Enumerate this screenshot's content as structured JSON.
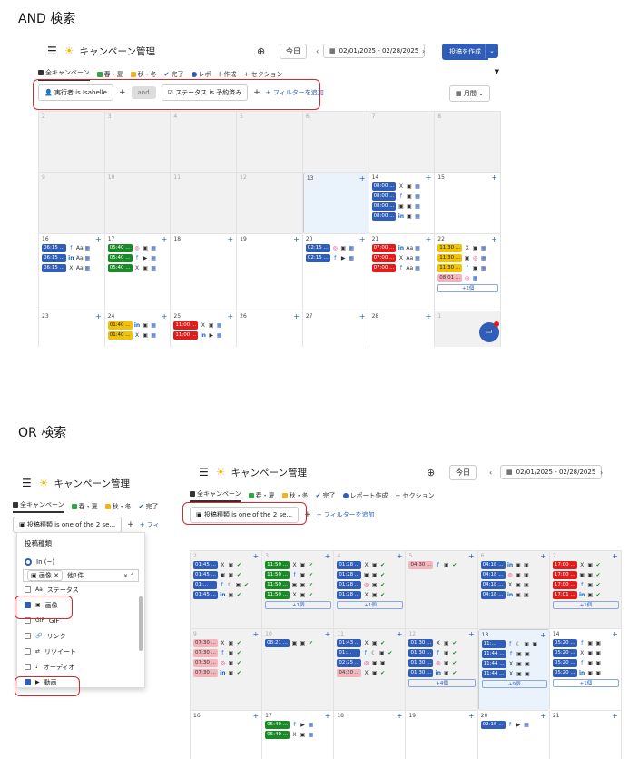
{
  "sections": {
    "and_title": "AND 検索",
    "or_title": "OR 検索"
  },
  "app": {
    "title": "キャンペーン管理",
    "today": "今日",
    "date_range": "02/01/2025 - 02/28/2025",
    "create_button": "投稿を作成",
    "view": "月間"
  },
  "tabs": [
    {
      "label": "全キャンペーン",
      "color": "#333333"
    },
    {
      "label": "春・夏",
      "color": "#2aa84a"
    },
    {
      "label": "秋・冬",
      "color": "#f2b321"
    },
    {
      "label": "完了",
      "color": "#2f5db7"
    },
    {
      "label": "レポート作成",
      "color": "#2f5db7"
    },
    {
      "label": "+ セクション",
      "color": ""
    }
  ],
  "filters_and": {
    "chip1": "実行者 is Isabelle",
    "and_label": "and",
    "chip2": "ステータス is 予約済み",
    "add": "+ フィルターを追加"
  },
  "filters_or": {
    "chip1": "投稿種類 is one of the 2 se...",
    "add": "+ フィルターを追加"
  },
  "dropdown": {
    "title": "投稿種類",
    "operator": "In (~)",
    "selected_chip": "画像",
    "selected_count": "他1件",
    "options": [
      {
        "label": "ステータス",
        "icon": "Aa",
        "checked": false
      },
      {
        "label": "画像",
        "icon": "image",
        "checked": true
      },
      {
        "label": "GIF",
        "icon": "GIF",
        "checked": false
      },
      {
        "label": "リンク",
        "icon": "link",
        "checked": false
      },
      {
        "label": "リツイート",
        "icon": "retweet",
        "checked": false
      },
      {
        "label": "オーディオ",
        "icon": "audio",
        "checked": false
      },
      {
        "label": "動画",
        "icon": "video",
        "checked": true
      }
    ],
    "row_peek": "07:30..."
  },
  "and_calendar": [
    [
      {
        "d": "2",
        "grey": true,
        "posts": []
      },
      {
        "d": "3",
        "grey": true,
        "posts": []
      },
      {
        "d": "4",
        "grey": true,
        "posts": []
      },
      {
        "d": "5",
        "grey": true,
        "posts": []
      },
      {
        "d": "6",
        "grey": true,
        "posts": []
      },
      {
        "d": "7",
        "grey": true,
        "posts": []
      },
      {
        "d": "8",
        "grey": true,
        "posts": []
      }
    ],
    [
      {
        "d": "9",
        "grey": true,
        "posts": []
      },
      {
        "d": "10",
        "grey": true,
        "posts": []
      },
      {
        "d": "11",
        "grey": true,
        "posts": []
      },
      {
        "d": "12",
        "grey": true,
        "posts": []
      },
      {
        "d": "13",
        "today": true,
        "posts": []
      },
      {
        "d": "14",
        "posts": [
          {
            "t": "08:00 ...",
            "c": "blue",
            "i": [
              "x",
              "img",
              "cal"
            ]
          },
          {
            "t": "08:00 ...",
            "c": "blue",
            "i": [
              "fb",
              "img",
              "cal"
            ]
          },
          {
            "t": "08:00 ...",
            "c": "blue",
            "i": [
              "img",
              "img",
              "cal"
            ]
          },
          {
            "t": "08:00 ...",
            "c": "blue",
            "i": [
              "li",
              "img",
              "cal"
            ]
          }
        ]
      },
      {
        "d": "15",
        "posts": []
      }
    ],
    [
      {
        "d": "16",
        "posts": [
          {
            "t": "06:15 ...",
            "c": "blue",
            "i": [
              "fb",
              "Aa",
              "cal"
            ]
          },
          {
            "t": "06:15 ...",
            "c": "blue",
            "i": [
              "li",
              "Aa",
              "cal"
            ]
          },
          {
            "t": "06:15 ...",
            "c": "blue",
            "i": [
              "x",
              "Aa",
              "cal"
            ]
          }
        ]
      },
      {
        "d": "17",
        "posts": [
          {
            "t": "05:40 ...",
            "c": "green",
            "i": [
              "ig",
              "img",
              "cal"
            ]
          },
          {
            "t": "05:40 ...",
            "c": "green",
            "i": [
              "fb",
              "vid",
              "cal"
            ]
          },
          {
            "t": "05:40 ...",
            "c": "green",
            "i": [
              "x",
              "img",
              "cal"
            ]
          }
        ]
      },
      {
        "d": "18",
        "posts": []
      },
      {
        "d": "19",
        "posts": []
      },
      {
        "d": "20",
        "posts": [
          {
            "t": "02:15 ...",
            "c": "blue",
            "i": [
              "ig",
              "img",
              "cal"
            ]
          },
          {
            "t": "02:15 ...",
            "c": "blue",
            "i": [
              "fb",
              "vid",
              "cal"
            ]
          }
        ]
      },
      {
        "d": "21",
        "posts": [
          {
            "t": "07:00 ...",
            "c": "red",
            "i": [
              "li",
              "Aa",
              "cal"
            ]
          },
          {
            "t": "07:00 ...",
            "c": "red",
            "i": [
              "x",
              "Aa",
              "cal"
            ]
          },
          {
            "t": "07:00 ...",
            "c": "red",
            "i": [
              "fb",
              "Aa",
              "cal"
            ]
          }
        ]
      },
      {
        "d": "22",
        "posts": [
          {
            "t": "11:30 ...",
            "c": "yellow",
            "i": [
              "x",
              "img",
              "cal"
            ]
          },
          {
            "t": "11:30 ...",
            "c": "yellow",
            "i": [
              "img",
              "ig",
              "cal"
            ]
          },
          {
            "t": "11:30 ...",
            "c": "yellow",
            "i": [
              "fb",
              "img",
              "cal"
            ]
          },
          {
            "t": "08:01 ...",
            "c": "pink",
            "i": [
              "ig",
              "cal"
            ]
          }
        ],
        "more": "+2個"
      }
    ],
    [
      {
        "d": "23",
        "posts": []
      },
      {
        "d": "24",
        "posts": [
          {
            "t": "01:40 ...",
            "c": "yellow",
            "i": [
              "li",
              "img",
              "cal"
            ]
          },
          {
            "t": "01:40 ...",
            "c": "yellow",
            "i": [
              "x",
              "img",
              "cal"
            ]
          }
        ]
      },
      {
        "d": "25",
        "posts": [
          {
            "t": "11:00 ...",
            "c": "red",
            "i": [
              "x",
              "img",
              "cal"
            ]
          },
          {
            "t": "11:00 ...",
            "c": "red",
            "i": [
              "li",
              "vid",
              "cal"
            ]
          }
        ]
      },
      {
        "d": "26",
        "posts": []
      },
      {
        "d": "27",
        "posts": []
      },
      {
        "d": "28",
        "posts": []
      },
      {
        "d": "1",
        "grey": true,
        "posts": []
      }
    ]
  ],
  "or_calendar": [
    [
      {
        "d": "2",
        "grey": true,
        "posts": [
          {
            "t": "01:45 ...",
            "c": "blue",
            "i": [
              "x",
              "img",
              "ck"
            ]
          },
          {
            "t": "01:45 ...",
            "c": "blue",
            "i": [
              "img",
              "img",
              "ck"
            ]
          },
          {
            "t": "01:...",
            "c": "blue",
            "i": [
              "fb",
              "moon",
              "img",
              "ck"
            ]
          },
          {
            "t": "01:45 ...",
            "c": "blue",
            "i": [
              "li",
              "img",
              "ck"
            ]
          }
        ]
      },
      {
        "d": "3",
        "grey": true,
        "posts": [
          {
            "t": "11:50 ...",
            "c": "green",
            "i": [
              "x",
              "img",
              "ck"
            ]
          },
          {
            "t": "11:50 ...",
            "c": "green",
            "i": [
              "fb",
              "img",
              "ck"
            ]
          },
          {
            "t": "11:50 ...",
            "c": "green",
            "i": [
              "img",
              "img",
              "ck"
            ]
          },
          {
            "t": "11:50 ...",
            "c": "green",
            "i": [
              "x",
              "img",
              "ck"
            ]
          }
        ],
        "more": "+1個"
      },
      {
        "d": "4",
        "grey": true,
        "posts": [
          {
            "t": "01:28 ...",
            "c": "blue",
            "i": [
              "x",
              "img",
              "ck"
            ]
          },
          {
            "t": "01:28 ...",
            "c": "blue",
            "i": [
              "img",
              "img",
              "ck"
            ]
          },
          {
            "t": "01:28 ...",
            "c": "blue",
            "i": [
              "ig",
              "img",
              "ck"
            ]
          },
          {
            "t": "01:28 ...",
            "c": "blue",
            "i": [
              "x",
              "img",
              "ck"
            ]
          }
        ],
        "more": "+1個"
      },
      {
        "d": "5",
        "grey": true,
        "posts": [
          {
            "t": "04:30 ...",
            "c": "pink",
            "i": [
              "fb",
              "img",
              "ck"
            ]
          }
        ]
      },
      {
        "d": "6",
        "grey": true,
        "posts": [
          {
            "t": "04:18 ...",
            "c": "blue",
            "i": [
              "li",
              "img",
              "img"
            ]
          },
          {
            "t": "04:18 ...",
            "c": "blue",
            "i": [
              "ig",
              "img",
              "img"
            ]
          },
          {
            "t": "04:18 ...",
            "c": "blue",
            "i": [
              "x",
              "img",
              "img"
            ]
          },
          {
            "t": "04:18 ...",
            "c": "blue",
            "i": [
              "li",
              "img",
              "img"
            ]
          }
        ]
      },
      {
        "d": "7",
        "grey": true,
        "posts": [
          {
            "t": "17:00 ...",
            "c": "red",
            "i": [
              "x",
              "img",
              "ck"
            ]
          },
          {
            "t": "17:00 ...",
            "c": "red",
            "i": [
              "img",
              "img",
              "ck"
            ]
          },
          {
            "t": "17:00 ...",
            "c": "red",
            "i": [
              "fb",
              "img",
              "ck"
            ]
          },
          {
            "t": "17:01 ...",
            "c": "red",
            "i": [
              "li",
              "img",
              "ck"
            ]
          }
        ],
        "more": "+1個"
      }
    ],
    [
      {
        "d": "9",
        "grey": true,
        "posts": [
          {
            "t": "07:30 ...",
            "c": "pink",
            "i": [
              "x",
              "img",
              "ck"
            ]
          },
          {
            "t": "07:30 ...",
            "c": "pink",
            "i": [
              "fb",
              "img",
              "ck"
            ]
          },
          {
            "t": "07:30 ...",
            "c": "pink",
            "i": [
              "ig",
              "img",
              "ck"
            ]
          },
          {
            "t": "07:30 ...",
            "c": "pink",
            "i": [
              "li",
              "img",
              "ck"
            ]
          }
        ]
      },
      {
        "d": "10",
        "grey": true,
        "posts": [
          {
            "t": "08:21 ...",
            "c": "blue",
            "i": [
              "img",
              "img",
              "ck"
            ]
          }
        ]
      },
      {
        "d": "11",
        "grey": true,
        "posts": [
          {
            "t": "01:43 ...",
            "c": "blue",
            "i": [
              "x",
              "img",
              "ck"
            ]
          },
          {
            "t": "01:...",
            "c": "blue",
            "i": [
              "fb",
              "moon",
              "img",
              "ck"
            ]
          },
          {
            "t": "02:25 ...",
            "c": "blue",
            "i": [
              "ig",
              "img",
              "img"
            ]
          },
          {
            "t": "04:30 ...",
            "c": "pink",
            "i": [
              "x",
              "img",
              "ck"
            ]
          }
        ]
      },
      {
        "d": "12",
        "grey": true,
        "posts": [
          {
            "t": "01:30 ...",
            "c": "blue",
            "i": [
              "x",
              "img",
              "ck"
            ]
          },
          {
            "t": "01:30 ...",
            "c": "blue",
            "i": [
              "fb",
              "img",
              "ck"
            ]
          },
          {
            "t": "01:30 ...",
            "c": "blue",
            "i": [
              "ig",
              "img",
              "ck"
            ]
          },
          {
            "t": "01:30 ...",
            "c": "blue",
            "i": [
              "li",
              "img",
              "ck"
            ]
          }
        ],
        "more": "+4個"
      },
      {
        "d": "13",
        "today": true,
        "posts": [
          {
            "t": "11:...",
            "c": "blue",
            "i": [
              "fb",
              "moon",
              "img",
              "img"
            ]
          },
          {
            "t": "11:44 ...",
            "c": "blue",
            "i": [
              "fb",
              "img",
              "img"
            ]
          },
          {
            "t": "11:44 ...",
            "c": "blue",
            "i": [
              "x",
              "img",
              "img"
            ]
          },
          {
            "t": "11:44 ...",
            "c": "blue",
            "i": [
              "x",
              "img",
              "img"
            ]
          }
        ],
        "more": "+9個"
      },
      {
        "d": "14",
        "posts": [
          {
            "t": "05:20 ...",
            "c": "blue",
            "i": [
              "fb",
              "img",
              "img"
            ]
          },
          {
            "t": "05:20 ...",
            "c": "blue",
            "i": [
              "x",
              "img",
              "img"
            ]
          },
          {
            "t": "05:20 ...",
            "c": "blue",
            "i": [
              "fb",
              "img",
              "img"
            ]
          },
          {
            "t": "05:20 ...",
            "c": "blue",
            "i": [
              "li",
              "img",
              "img"
            ]
          }
        ],
        "more": "+1個"
      }
    ],
    [
      {
        "d": "16",
        "posts": []
      },
      {
        "d": "17",
        "posts": [
          {
            "t": "05:40 ...",
            "c": "green",
            "i": [
              "fb",
              "vid",
              "cal"
            ]
          },
          {
            "t": "05:40 ...",
            "c": "green",
            "i": [
              "x",
              "img",
              "cal"
            ]
          }
        ]
      },
      {
        "d": "18",
        "posts": []
      },
      {
        "d": "19",
        "posts": []
      },
      {
        "d": "20",
        "posts": [
          {
            "t": "02:15 ...",
            "c": "blue",
            "i": [
              "fb",
              "vid",
              "cal"
            ]
          }
        ]
      },
      {
        "d": "21",
        "posts": []
      }
    ]
  ],
  "icons": {
    "x": "X",
    "fb": "f",
    "li": "in",
    "ig": "◎",
    "img": "▣",
    "vid": "▶",
    "cal": "▦",
    "ck": "✔",
    "Aa": "Aa",
    "moon": "☾"
  }
}
